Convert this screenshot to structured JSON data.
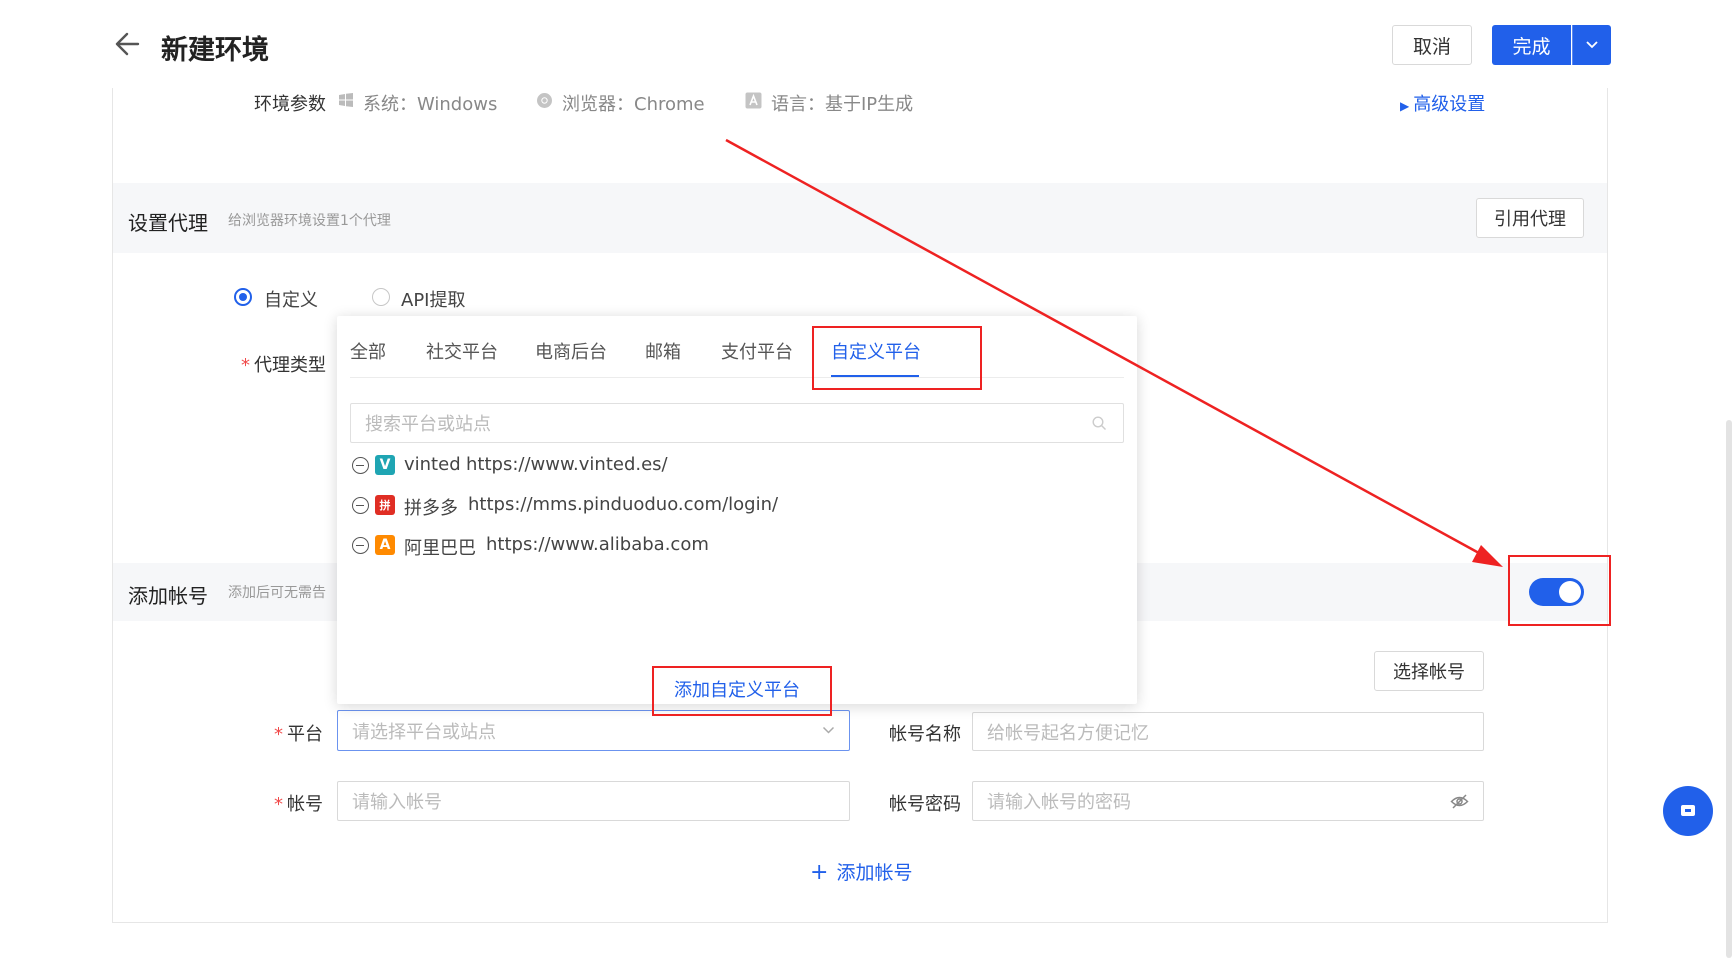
{
  "header": {
    "title": "新建环境",
    "cancel_label": "取消",
    "done_label": "完成"
  },
  "env_params": {
    "label": "环境参数",
    "system": "系统：Windows",
    "browser": "浏览器：Chrome",
    "language": "语言：基于IP生成",
    "advanced": "高级设置"
  },
  "proxy": {
    "title": "设置代理",
    "desc": "给浏览器环境设置1个代理",
    "quote_button": "引用代理",
    "radio_custom": "自定义",
    "radio_api": "API提取",
    "type_label": "代理类型"
  },
  "account": {
    "title": "添加帐号",
    "desc_partial": "添加后可无需告",
    "select_button": "选择帐号",
    "platform_label": "平台",
    "platform_placeholder": "请选择平台或站点",
    "name_label": "帐号名称",
    "name_placeholder": "给帐号起名方便记忆",
    "account_label": "帐号",
    "account_placeholder": "请输入帐号",
    "password_label": "帐号密码",
    "password_placeholder": "请输入帐号的密码",
    "add_account": "添加帐号",
    "toggle_on": true
  },
  "dropdown": {
    "tabs": [
      "全部",
      "社交平台",
      "电商后台",
      "邮箱",
      "支付平台",
      "自定义平台"
    ],
    "active_tab": "自定义平台",
    "search_placeholder": "搜索平台或站点",
    "items": [
      {
        "name": "vinted",
        "url": "https://www.vinted.es/",
        "logo_color": "#1fa5b3",
        "logo_text": "V"
      },
      {
        "name": "拼多多",
        "url": "https://mms.pinduoduo.com/login/",
        "logo_color": "#e02e24",
        "logo_text": "拼"
      },
      {
        "name": "阿里巴巴",
        "url": "https://www.alibaba.com",
        "logo_color": "#ff8a00",
        "logo_text": "A"
      }
    ],
    "add_custom": "添加自定义平台"
  },
  "colors": {
    "accent": "#2160ea",
    "annotation": "#ee2222"
  }
}
